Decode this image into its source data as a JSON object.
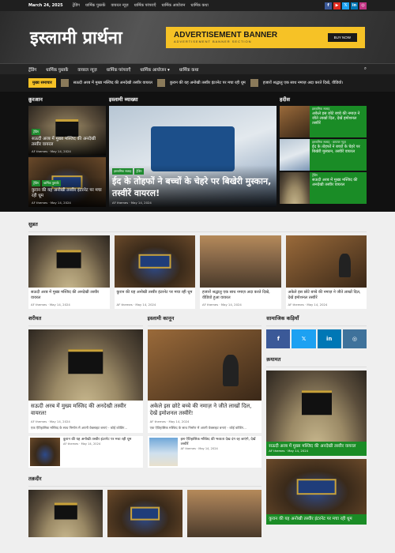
{
  "topbar": {
    "date": "March 24, 2025",
    "links": [
      "ट्रेंडिंग",
      "धार्मिक पुस्तकें",
      "वायरल न्यूज़",
      "धार्मिक परंपराएँ",
      "धार्मिक आयोजन",
      "धार्मिक कथा"
    ],
    "social": [
      "f",
      "▶",
      "𝕏",
      "in",
      "◎"
    ]
  },
  "site": {
    "logo": "इस्लामी प्रार्थना"
  },
  "ad": {
    "title": "ADVERTISEMENT BANNER",
    "sub": "ADVERTISEMENT BANNER SECTION",
    "btn": "BUY NOW"
  },
  "nav": [
    "ट्रेंडिंग",
    "धार्मिक पुस्तकें",
    "वायरल न्यूज़",
    "धार्मिक परंपराएँ",
    "धार्मिक आयोजन ▾",
    "धार्मिक कथा"
  ],
  "ticker": {
    "label": "मुख्य समाचार",
    "items": [
      "सऊदी अरब में मुख्य मस्जिद की अनदेखी तस्वीर वायरल",
      "कुरान की यह अनोखी तस्वीर इंटरनेट पर मचा रही धूम",
      "हजारों श्रद्धालु एक साथ नमाज़ अदा करते दिखे, वीडियो।"
    ]
  },
  "hero": {
    "col1": "क़ुरआन",
    "col2": "इस्लामी व्याख्या",
    "col3": "हदीस",
    "left": [
      {
        "tags": [
          "ट्रेंडिंग"
        ],
        "title": "सऊदी अरब में मुख्य मस्जिद की अनदेखी तस्वीर वायरल",
        "meta": "AF themes · May 14, 2024"
      },
      {
        "tags": [
          "ट्रेंडिंग",
          "धार्मिक पुस्तकें"
        ],
        "title": "कुरान की यह अनोखी तस्वीर इंटरनेट पर मचा रही धूम",
        "meta": "AF themes · May 14, 2024"
      }
    ],
    "main": {
      "tags": [
        "इस्लामिक सलाह",
        "ट्रेंडिंग"
      ],
      "title": "ईद के तोहफों ने बच्चों के चेहरे पर बिखेरी मुस्कान, तस्वीरें वायरल!",
      "meta": "AF themes · May 14, 2024"
    },
    "right": [
      {
        "tag": "इस्लामिक सलाह",
        "title": "अकेले इस छोटे बच्चे की नमाज़ ने जीते लाखों दिल, देखें इमोशनल तस्वीरें"
      },
      {
        "tag": "इस्लामिक सलाह · वायरल न्यूज़",
        "title": "ईद के तोहफों ने बच्चों के चेहरे पर बिखेरी मुस्कान, तस्वीरें वायरल"
      },
      {
        "tag": "ट्रेंडिंग",
        "title": "सऊदी अरब में मुख्य मस्जिद की अनदेखी तस्वीर वायरल"
      }
    ]
  },
  "sunnah": {
    "title": "सुन्नत",
    "items": [
      {
        "title": "सऊदी अरब में मुख्य मस्जिद की अनदेखी तस्वीर वायरल",
        "meta": "AF themes · May 14, 2024"
      },
      {
        "title": "कुरान की यह अनोखी तस्वीर इंटरनेट पर मचा रही धूम",
        "meta": "AF themes · May 14, 2024"
      },
      {
        "title": "हजारों श्रद्धालु एक साथ नमाज़ अदा करते दिखे, वीडियो हुआ वायरल",
        "meta": "AF themes · May 14, 2024"
      },
      {
        "title": "अकेले इस छोटे बच्चे की नमाज़ ने जीते लाखों दिल, देखें इमोशनल तस्वीरें",
        "meta": "AF themes · May 14, 2024"
      }
    ]
  },
  "shariat": {
    "title": "शरीयत",
    "main": {
      "title": "सऊदी अरब में मुख्य मस्जिद की अनदेखी तस्वीर वायरल!",
      "meta": "AF themes · May 14, 2024",
      "ex": "एक ऐतिहासिक मस्जिद के साथ निर्माण में अपनी वेबसाइट बनाएं - कोई कोडिंग..."
    },
    "mini": {
      "title": "कुरान की यह अनोखी तस्वीर इंटरनेट पर मचा रही धूम",
      "meta": "AF themes · May 14, 2024"
    }
  },
  "kanoon": {
    "title": "इस्लामी कानून",
    "main": {
      "title": "अकेले इस छोटे बच्चे की नमाज़ ने जीते लाखों दिल, देखें इमोशनल तस्वीरें!",
      "meta": "AF themes · May 14, 2024",
      "ex": "एक ऐतिहासिक मस्जिद के साथ निर्माण में अपनी वेबसाइट बनाएं - कोई कोडिंग..."
    },
    "mini": {
      "title": "इस ऐतिहासिक मस्जिद की भव्यता देख दंग रह जाएंगे, देखें तस्वीरें",
      "meta": "AF themes · May 14, 2024"
    }
  },
  "social": {
    "title": "सामाजिक कड़ियाँ",
    "icons": [
      "f",
      "𝕏",
      "in",
      "◎"
    ]
  },
  "qayamat": {
    "title": "क़यामत",
    "items": [
      {
        "title": "सऊदी अरब में मुख्य मस्जिद की अनदेखी तस्वीर वायरल",
        "meta": "AF themes · May 14, 2024"
      },
      {
        "title": "कुरान की यह अनोखी तस्वीर इंटरनेट पर मचा रही धूम"
      }
    ]
  },
  "taqdeer": {
    "title": "तक़दीर"
  }
}
